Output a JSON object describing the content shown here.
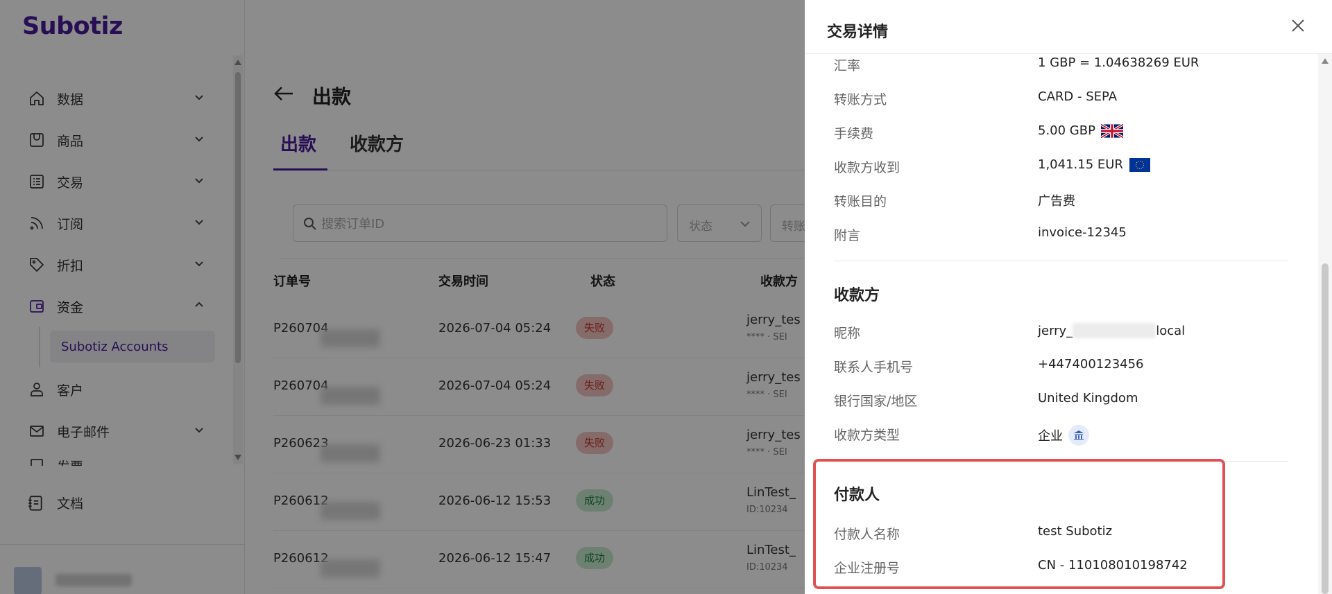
{
  "app": {
    "logo": "Subotiz"
  },
  "sidebar": {
    "items": [
      {
        "label": "数据",
        "icon": "home-icon"
      },
      {
        "label": "商品",
        "icon": "store-icon"
      },
      {
        "label": "交易",
        "icon": "list-icon"
      },
      {
        "label": "订阅",
        "icon": "rss-icon"
      },
      {
        "label": "折扣",
        "icon": "tag-icon"
      },
      {
        "label": "资金",
        "icon": "wallet-icon"
      },
      {
        "label": "客户",
        "icon": "user-icon"
      },
      {
        "label": "电子邮件",
        "icon": "mail-icon"
      },
      {
        "label": "发票",
        "icon": "invoice-icon"
      }
    ],
    "sub_item": "Subotiz Accounts",
    "doc": "文档"
  },
  "main": {
    "page_title": "出款",
    "tabs": [
      "出款",
      "收款方"
    ],
    "search_placeholder": "搜索订单ID",
    "filter_status": "状态",
    "filter_transfer": "转账",
    "headers": [
      "订单号",
      "交易时间",
      "状态",
      "收款方"
    ],
    "rows": [
      {
        "oid": "P260704",
        "time": "2026-07-04 05:24",
        "status": "失败",
        "status_type": "fail",
        "payee": "jerry_tes",
        "payee_sub": "**** · SEI"
      },
      {
        "oid": "P260704",
        "time": "2026-07-04 05:24",
        "status": "失败",
        "status_type": "fail",
        "payee": "jerry_tes",
        "payee_sub": "**** · SEI"
      },
      {
        "oid": "P260623",
        "time": "2026-06-23 01:33",
        "status": "失败",
        "status_type": "fail",
        "payee": "jerry_tes",
        "payee_sub": "**** · SEI"
      },
      {
        "oid": "P260612",
        "time": "2026-06-12 15:53",
        "status": "成功",
        "status_type": "ok",
        "payee": "LinTest_",
        "payee_sub": "ID:10234"
      },
      {
        "oid": "P260612",
        "time": "2026-06-12 15:47",
        "status": "成功",
        "status_type": "ok",
        "payee": "LinTest_",
        "payee_sub": "ID:10234"
      }
    ]
  },
  "drawer": {
    "title": "交易详情",
    "details": [
      {
        "k": "汇率",
        "v": "1 GBP = 1.04638269 EUR"
      },
      {
        "k": "转账方式",
        "v": "CARD - SEPA"
      },
      {
        "k": "手续费",
        "v": "5.00 GBP"
      },
      {
        "k": "收款方收到",
        "v": "1,041.15 EUR"
      },
      {
        "k": "转账目的",
        "v": "广告费"
      },
      {
        "k": "附言",
        "v": "invoice-12345"
      }
    ],
    "payee_section": "收款方",
    "payee": [
      {
        "k": "昵称",
        "v_pre": "jerry_",
        "v_post": "local"
      },
      {
        "k": "联系人手机号",
        "v": "+447400123456"
      },
      {
        "k": "银行国家/地区",
        "v": "United Kingdom"
      },
      {
        "k": "收款方类型",
        "v": "企业"
      }
    ],
    "payer_section": "付款人",
    "payer": [
      {
        "k": "付款人名称",
        "v": "test Subotiz"
      },
      {
        "k": "企业注册号",
        "v": "CN - 110108010198742"
      }
    ]
  },
  "colors": {
    "brand": "#4a1c9b",
    "highlight": "#e05252",
    "fail_bg": "#f5c4c4",
    "ok_bg": "#c6ebd0"
  }
}
